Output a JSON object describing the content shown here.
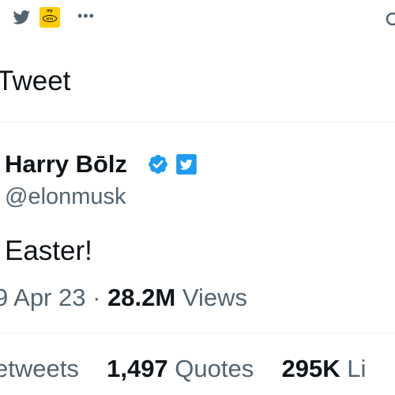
{
  "status_bar": {
    "icons": [
      "twitter-bird-icon",
      "mtn-app-icon",
      "more-dots-icon",
      "partial-icon"
    ],
    "mtn_icon_text_top": "my",
    "mtn_icon_text_bottom": "MTN",
    "more_label": "•••"
  },
  "header": {
    "title": "Tweet"
  },
  "tweet": {
    "author_name": "Harry Bōlz",
    "handle": "@elonmusk",
    "badges": [
      "verified-badge-icon",
      "twitter-badge-icon"
    ],
    "text": "Easter!",
    "date": "9 Apr 23",
    "separator": "·",
    "views_count": "28.2M",
    "views_label": "Views"
  },
  "stats": {
    "retweets_label": "Retweets",
    "retweets_visible": "etweets",
    "quotes_count": "1,497",
    "quotes_label": "Quotes",
    "likes_count": "295K",
    "likes_visible": "Li"
  },
  "colors": {
    "text_primary": "#0f1419",
    "text_secondary": "#536471",
    "verified_blue": "#1d9bf0",
    "twitter_blue": "#1d9bf0",
    "mtn_yellow": "#ffcc00",
    "divider": "#eff3f4"
  }
}
